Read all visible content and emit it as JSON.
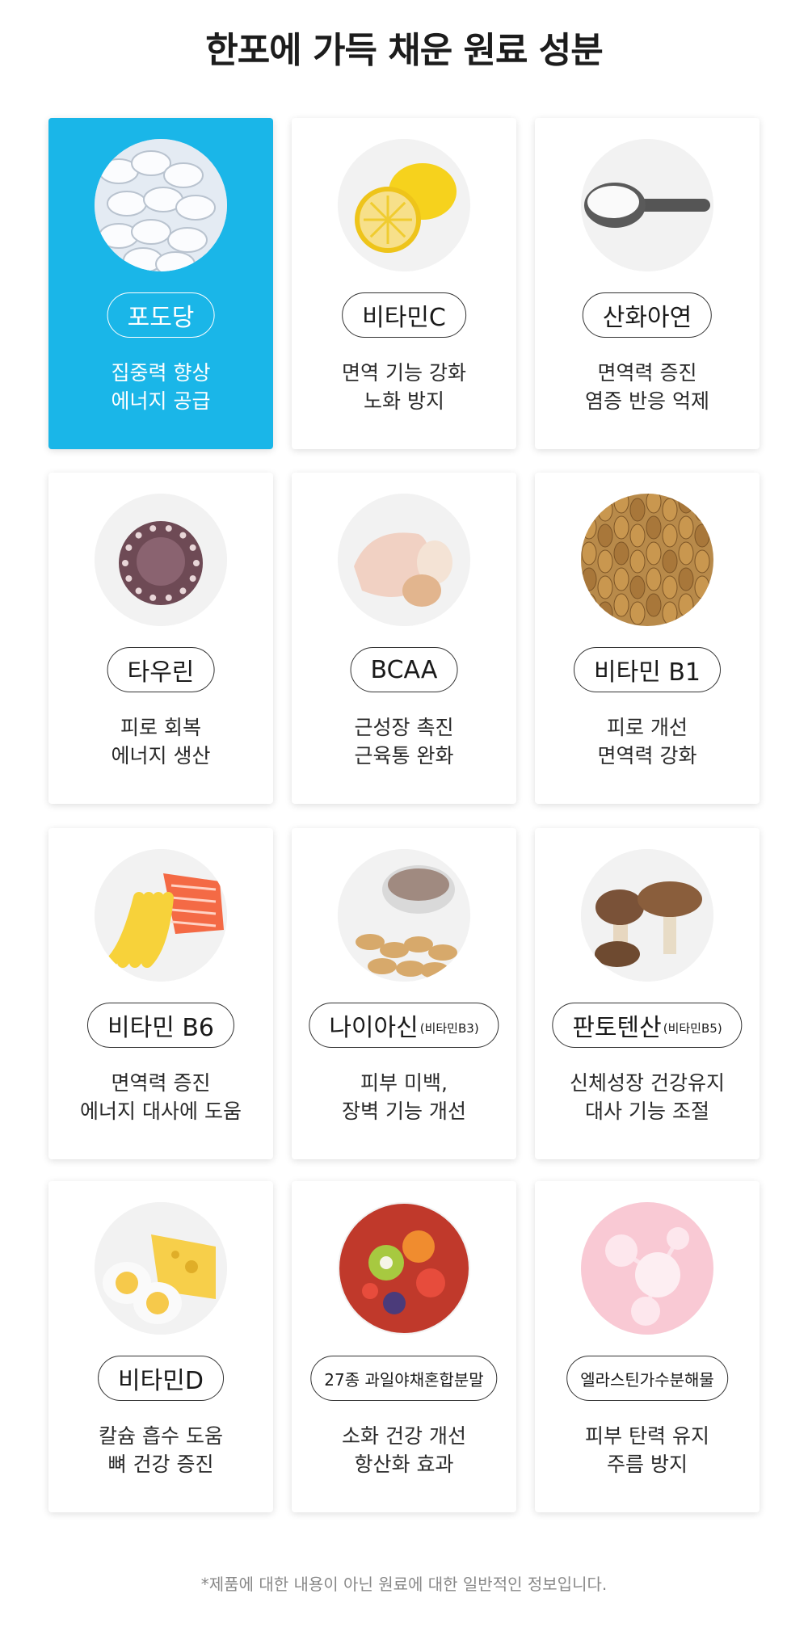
{
  "title": "한포에 가득 채운 원료 성분",
  "accent_color": "#1ab6e8",
  "items": [
    {
      "name": "포도당",
      "sub": "",
      "desc": [
        "집중력 향상",
        "에너지 공급"
      ],
      "icon": "glucose-tablets-icon",
      "active": true
    },
    {
      "name": "비타민C",
      "sub": "",
      "desc": [
        "면역 기능 강화",
        "노화 방지"
      ],
      "icon": "lemon-icon",
      "active": false
    },
    {
      "name": "산화아연",
      "sub": "",
      "desc": [
        "면역력 증진",
        "염증 반응 억제"
      ],
      "icon": "powder-scoop-icon",
      "active": false
    },
    {
      "name": "타우린",
      "sub": "",
      "desc": [
        "피로 회복",
        "에너지 생산"
      ],
      "icon": "octopus-icon",
      "active": false
    },
    {
      "name": "BCAA",
      "sub": "",
      "desc": [
        "근성장 촉진",
        "근육통 완화"
      ],
      "icon": "chicken-egg-icon",
      "active": false
    },
    {
      "name": "비타민 B1",
      "sub": "",
      "desc": [
        "피로 개선",
        "면역력 강화"
      ],
      "icon": "wheat-grain-icon",
      "active": false
    },
    {
      "name": "비타민 B6",
      "sub": "",
      "desc": [
        "면역력 증진",
        "에너지 대사에 도움"
      ],
      "icon": "banana-salmon-icon",
      "active": false
    },
    {
      "name": "나이아신",
      "sub": "(비타민B3)",
      "desc": [
        "피부 미백,",
        "장벽 기능 개선"
      ],
      "icon": "peanut-rice-icon",
      "active": false
    },
    {
      "name": "판토텐산",
      "sub": "(비타민B5)",
      "desc": [
        "신체성장 건강유지",
        "대사 기능 조절"
      ],
      "icon": "mushroom-icon",
      "active": false
    },
    {
      "name": "비타민D",
      "sub": "",
      "desc": [
        "칼슘 흡수 도움",
        "뼈 건강 증진"
      ],
      "icon": "cheese-egg-icon",
      "active": false
    },
    {
      "name": "27종 과일야채혼합분말",
      "sub": "",
      "desc": [
        "소화 건강 개선",
        "항산화 효과"
      ],
      "icon": "fruit-bowl-icon",
      "active": false
    },
    {
      "name": "엘라스틴가수분해물",
      "sub": "",
      "desc": [
        "피부 탄력 유지",
        "주름 방지"
      ],
      "icon": "molecule-icon",
      "active": false
    }
  ],
  "footnote": "*제품에 대한 내용이 아닌 원료에 대한 일반적인 정보입니다."
}
